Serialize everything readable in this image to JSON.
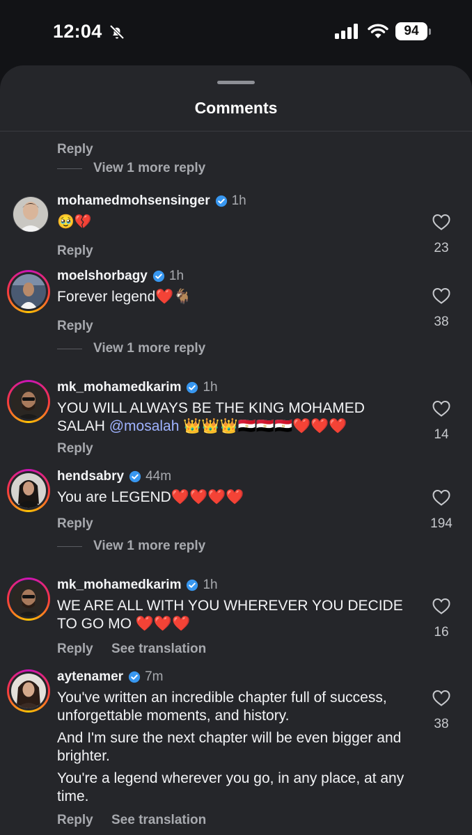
{
  "status": {
    "time": "12:04",
    "battery": "94"
  },
  "sheet": {
    "title": "Comments"
  },
  "top_thread": {
    "reply_label": "Reply",
    "more_replies": "View 1 more reply"
  },
  "comments": [
    {
      "username": "mohamedmohsensinger",
      "time": "1h",
      "text": "🥹💔",
      "likes": "23",
      "reply": "Reply"
    },
    {
      "username": "moelshorbagy",
      "time": "1h",
      "text": "Forever legend❤️🐐",
      "likes": "38",
      "reply": "Reply",
      "more_replies": "View 1 more reply"
    },
    {
      "username": "mk_mohamedkarim",
      "time": "1h",
      "text_before": "YOU WILL ALWAYS BE THE KING MOHAMED SALAH ",
      "mention": "@mosalah",
      "text_after": " 👑👑👑🇪🇬🇪🇬🇪🇬❤️❤️❤️",
      "likes": "14",
      "reply": "Reply"
    },
    {
      "username": "hendsabry",
      "time": "44m",
      "text": "You are LEGEND❤️❤️❤️❤️",
      "likes": "194",
      "reply": "Reply",
      "more_replies": "View 1 more reply"
    },
    {
      "username": "mk_mohamedkarim",
      "time": "1h",
      "text": "WE ARE ALL WITH YOU WHEREVER YOU DECIDE TO GO MO ❤️❤️❤️",
      "likes": "16",
      "reply": "Reply",
      "translation": "See translation"
    },
    {
      "username": "aytenamer",
      "time": "7m",
      "paragraphs": [
        "You've written an incredible chapter full of success, unforgettable moments, and history.",
        "And I'm sure the next chapter will be even bigger and brighter.",
        "You're a legend wherever you go, in any place, at any time."
      ],
      "likes": "38",
      "reply": "Reply",
      "translation": "See translation"
    }
  ],
  "colors": {
    "background": "#121316",
    "sheet": "#25262a",
    "verified": "#3897f0",
    "mention": "#9fb3ff",
    "muted": "#a7a9ae"
  },
  "icons": [
    "bell-off-icon",
    "signal-icon",
    "wifi-icon",
    "battery-icon",
    "verified-badge-icon",
    "heart-outline-icon"
  ]
}
